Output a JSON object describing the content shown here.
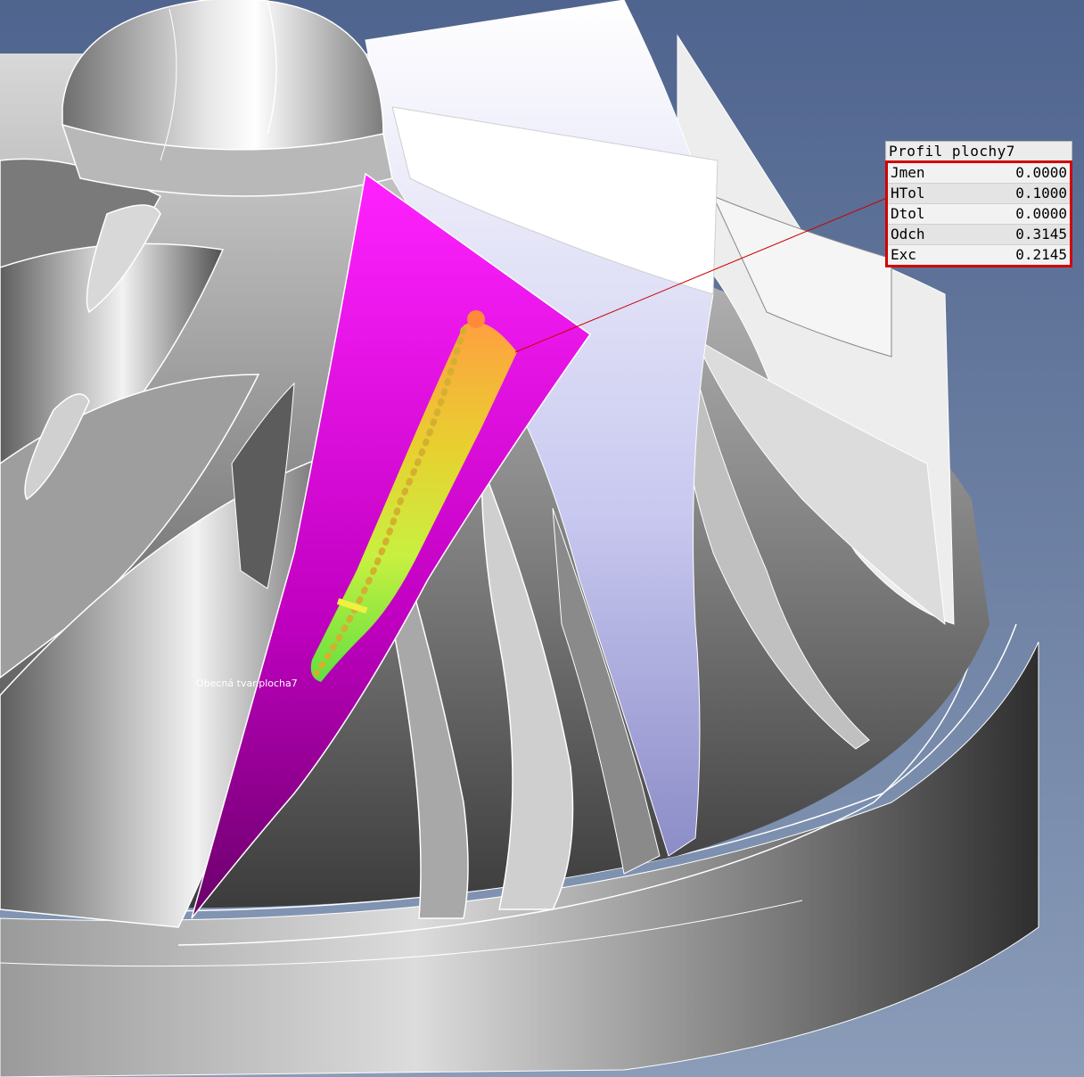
{
  "viewport": {
    "background_top": "#4f648e",
    "background_bottom": "#8a9cb8",
    "highlight_color": "#ff00ff",
    "leader_line_color": "#cc0000"
  },
  "surface_label": "Obecná tvar.plocha7",
  "profile_panel": {
    "title": "Profil plochy7",
    "border_color": "#d40000",
    "rows": [
      {
        "key": "Jmen",
        "value": "0.0000"
      },
      {
        "key": "HTol",
        "value": "0.1000"
      },
      {
        "key": "Dtol",
        "value": "0.0000"
      },
      {
        "key": "Odch",
        "value": "0.3145"
      },
      {
        "key": "Exc",
        "value": "0.2145"
      }
    ]
  }
}
